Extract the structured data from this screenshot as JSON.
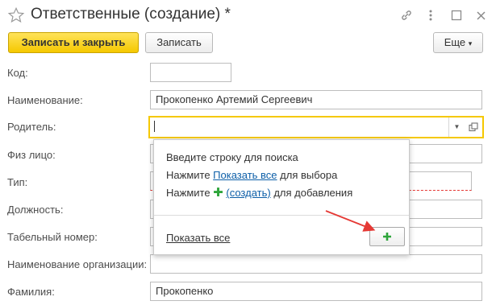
{
  "window": {
    "title": "Ответственные (создание) *",
    "icons": [
      "star-icon",
      "link-icon",
      "more-vertical-icon",
      "restore-icon",
      "close-icon"
    ]
  },
  "toolbar": {
    "save_close_label": "Записать и закрыть",
    "save_label": "Записать",
    "more_label": "Еще",
    "more_caret": "▾"
  },
  "form": {
    "code": {
      "label": "Код:",
      "value": ""
    },
    "name": {
      "label": "Наименование:",
      "value": "Прокопенко Артемий Сергеевич"
    },
    "parent": {
      "label": "Родитель:",
      "value": ""
    },
    "individual": {
      "label": "Физ лицо:",
      "value": ""
    },
    "type": {
      "label": "Тип:",
      "value": ""
    },
    "position": {
      "label": "Должность:",
      "value": ""
    },
    "personnel_number": {
      "label": "Табельный номер:",
      "value": ""
    },
    "organization_name": {
      "label": "Наименование организации:",
      "value": ""
    },
    "surname": {
      "label": "Фамилия:",
      "value": "Прокопенко"
    }
  },
  "popup": {
    "line1": "Введите строку для поиска",
    "line2_prefix": "Нажмите ",
    "line2_link": "Показать все",
    "line2_suffix": " для выбора",
    "line3_prefix": "Нажмите ",
    "line3_plus": "✚",
    "line3_link": "(создать)",
    "line3_suffix": " для добавления",
    "show_all_link": "Показать все",
    "add_button_icon": "plus-icon"
  },
  "colors": {
    "primary_button": "#f5c800",
    "focus_border": "#f5c800",
    "link": "#0d5fa8",
    "plus": "#2ea53b",
    "arrow": "#e53935",
    "required_underline": "#e53935"
  }
}
